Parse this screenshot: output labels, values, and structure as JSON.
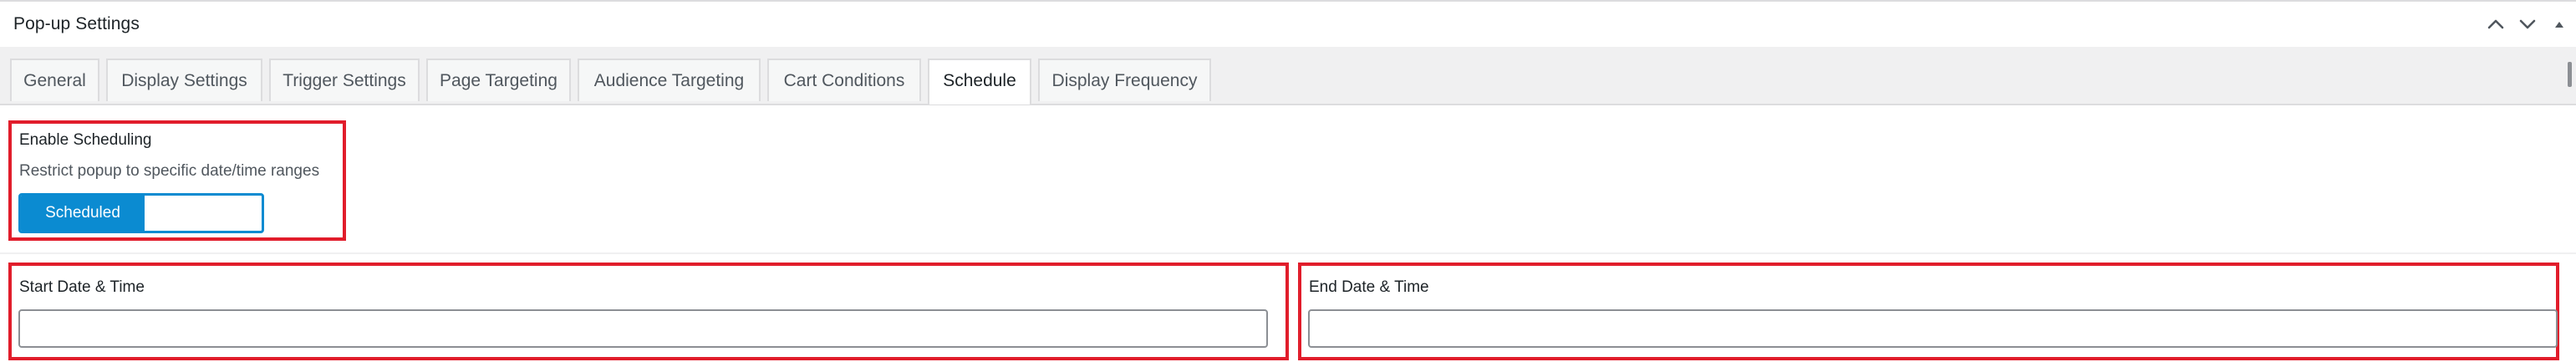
{
  "panel": {
    "title": "Pop-up Settings",
    "controls": [
      {
        "name": "move-up",
        "icon": "chevron-up-icon"
      },
      {
        "name": "move-down",
        "icon": "chevron-down-icon"
      },
      {
        "name": "toggle-panel",
        "icon": "triangle-up-icon"
      }
    ]
  },
  "tabs": [
    {
      "label": "General",
      "active": false
    },
    {
      "label": "Display Settings",
      "active": false
    },
    {
      "label": "Trigger Settings",
      "active": false
    },
    {
      "label": "Page Targeting",
      "active": false
    },
    {
      "label": "Audience Targeting",
      "active": false
    },
    {
      "label": "Cart Conditions",
      "active": false
    },
    {
      "label": "Schedule",
      "active": true
    },
    {
      "label": "Display Frequency",
      "active": false
    }
  ],
  "schedule": {
    "enable": {
      "label": "Enable Scheduling",
      "description": "Restrict popup to specific date/time ranges",
      "toggle_label": "Scheduled",
      "enabled": true
    },
    "start": {
      "label": "Start Date & Time",
      "value": "",
      "placeholder": ""
    },
    "end": {
      "label": "End Date & Time",
      "value": "",
      "placeholder": ""
    }
  },
  "colors": {
    "accent": "#0b8bd1",
    "highlight": "#e11d2b"
  }
}
